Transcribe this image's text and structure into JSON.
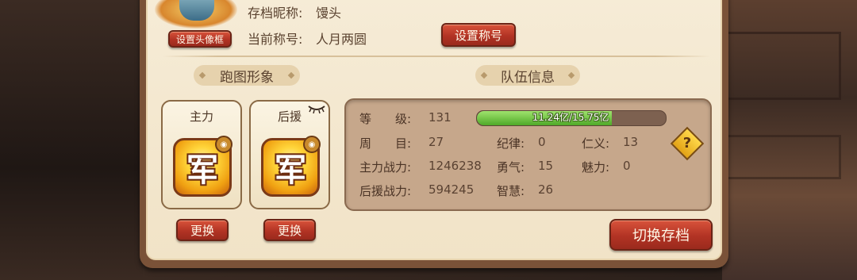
{
  "profile": {
    "nickname_label": "存档昵称:",
    "nickname_value": "馒头",
    "title_label": "当前称号:",
    "title_value": "人月两圆",
    "set_frame_button": "设置头像框",
    "set_title_button": "设置称号"
  },
  "sections": {
    "appearance": "跑图形象",
    "team_info": "队伍信息"
  },
  "slots": [
    {
      "title": "主力",
      "emblem": "军",
      "change_button": "更换"
    },
    {
      "title": "后援",
      "emblem": "军",
      "change_button": "更换"
    }
  ],
  "team": {
    "level_label": "等　　级:",
    "level_value": "131",
    "exp_text": "11.24亿/15.75亿",
    "exp_progress": 0.714,
    "round_label": "周　　目:",
    "round_value": "27",
    "main_power_label": "主力战力:",
    "main_power_value": "1246238",
    "support_power_label": "后援战力:",
    "support_power_value": "594245",
    "discipline_label": "纪律:",
    "discipline_value": "0",
    "courage_label": "勇气:",
    "courage_value": "15",
    "wisdom_label": "智慧:",
    "wisdom_value": "26",
    "benevolence_label": "仁义:",
    "benevolence_value": "13",
    "charm_label": "魅力:",
    "charm_value": "0"
  },
  "switch_save_button": "切换存档",
  "help_symbol": "?",
  "colors": {
    "accent_red": "#b23324",
    "exp_green": "#4fa928",
    "panel_bg": "#f4e8d0"
  }
}
